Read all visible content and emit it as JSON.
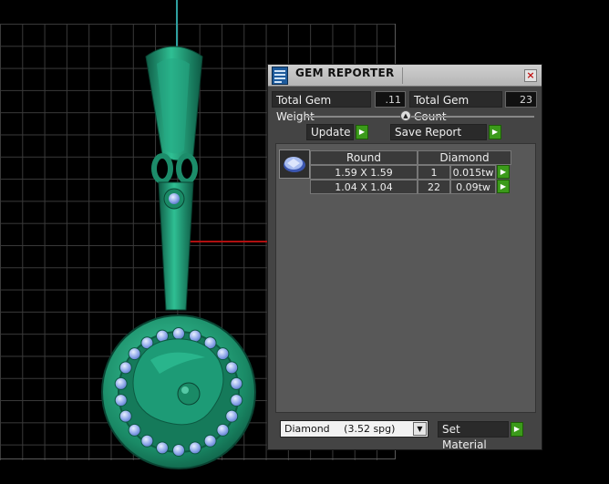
{
  "panel": {
    "title": "GEM REPORTER",
    "close_glyph": "×",
    "total_gem_weight_label": "Total Gem Weight",
    "total_gem_weight_value": ".11",
    "total_gem_count_label": "Total Gem Count",
    "total_gem_count_value": "23",
    "update_label": "Update",
    "save_report_label": "Save Report",
    "go_glyph": "▶"
  },
  "table": {
    "shape_header": "Round",
    "material_header": "Diamond",
    "rows": [
      {
        "size": "1.59 X 1.59",
        "count": "1",
        "weight": "0.015tw"
      },
      {
        "size": "1.04 X 1.04",
        "count": "22",
        "weight": "0.09tw"
      }
    ]
  },
  "material": {
    "name": "Diamond",
    "density": "(3.52 spg)",
    "set_label": "Set Material"
  },
  "colors": {
    "pendant": "#1f9a77",
    "gem": "#9fb8f0",
    "axis_x": "#b01010",
    "axis_y": "#2fa0a0",
    "go_button": "#3b9a1a"
  },
  "icons": [
    "gem-reporter-icon",
    "close-icon",
    "slider-knob-icon",
    "go-arrow-icon",
    "round-gem-icon",
    "dropdown-arrow-icon"
  ]
}
